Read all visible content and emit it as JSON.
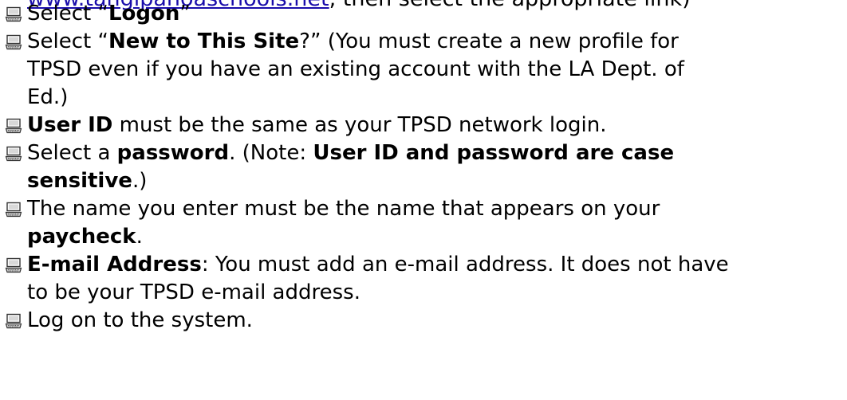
{
  "header_cutoff": {
    "link_text": "www.tangipahoaschools.net",
    "rest_text": ", then select the appropriate link)"
  },
  "items": [
    {
      "icon": "computer-icon",
      "segments": [
        {
          "t": "Select “",
          "b": false
        },
        {
          "t": "Logon",
          "b": true
        },
        {
          "t": "”",
          "b": false
        }
      ]
    },
    {
      "icon": "computer-icon",
      "segments": [
        {
          "t": "Select “",
          "b": false
        },
        {
          "t": "New to This Site",
          "b": true
        },
        {
          "t": "?” (You must create a new profile for",
          "b": false
        },
        {
          "br": true
        },
        {
          "t": "TPSD even if you have an existing account with the LA Dept. of",
          "b": false
        },
        {
          "br": true
        },
        {
          "t": "Ed.)",
          "b": false
        }
      ]
    },
    {
      "icon": "computer-icon",
      "segments": [
        {
          "t": "User ID",
          "b": true
        },
        {
          "t": " must be the same as your TPSD network login.",
          "b": false
        }
      ]
    },
    {
      "icon": "computer-icon",
      "segments": [
        {
          "t": "Select a ",
          "b": false
        },
        {
          "t": "password",
          "b": true
        },
        {
          "t": ". (Note: ",
          "b": false
        },
        {
          "t": "User ID and password are case",
          "b": true
        },
        {
          "br": true
        },
        {
          "t": "sensitive",
          "b": true
        },
        {
          "t": ".)",
          "b": false
        }
      ]
    },
    {
      "icon": "computer-icon",
      "segments": [
        {
          "t": "The name you enter must be the name that appears on your",
          "b": false
        },
        {
          "br": true
        },
        {
          "t": "paycheck",
          "b": true
        },
        {
          "t": ".",
          "b": false
        }
      ]
    },
    {
      "icon": "computer-icon",
      "segments": [
        {
          "t": "E-mail Address",
          "b": true
        },
        {
          "t": ":  You must add an e-mail address. It does not have",
          "b": false
        },
        {
          "br": true
        },
        {
          "t": "to be your TPSD e-mail address.",
          "b": false
        }
      ]
    },
    {
      "icon": "computer-icon",
      "segments": [
        {
          "t": "Log on to the system.",
          "b": false
        }
      ]
    }
  ]
}
